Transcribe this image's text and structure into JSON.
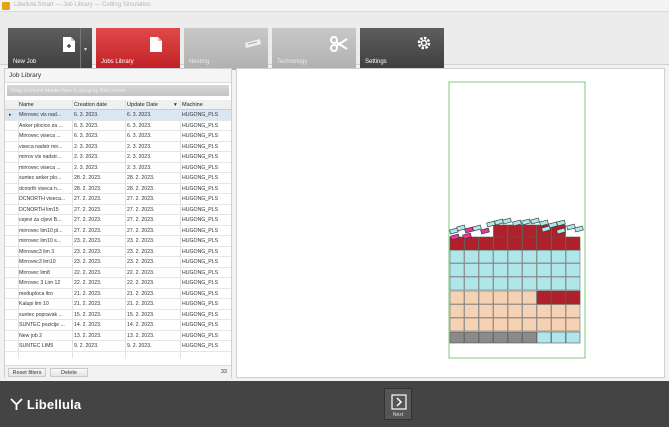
{
  "window": {
    "title": "Libellula.Smart — Job Library — Cutting Simulation"
  },
  "ribbon": {
    "new_job": "New Job",
    "job_library": "Jobs Library",
    "nesting": "Nesting",
    "technology": "Technology",
    "settings": "Settings"
  },
  "panel": {
    "title": "Job Library",
    "group_hint": "Drag a column header here to group by that column",
    "columns": [
      "Name",
      "Creation date",
      "Update Date",
      "Machine"
    ],
    "rows": [
      [
        "Mirrovec vis nad...",
        "6. 3. 2023.",
        "6. 3. 2023.",
        "HUGONG_PLS"
      ],
      [
        "Anker plocice za ...",
        "6. 3. 2023.",
        "6. 3. 2023.",
        "HUGONG_PLS"
      ],
      [
        "Mirrovec viseca ...",
        "6. 3. 2023.",
        "6. 3. 2023.",
        "HUGONG_PLS"
      ],
      [
        "viseca nadstr mir...",
        "2. 3. 2023.",
        "2. 3. 2023.",
        "HUGONG_PLS"
      ],
      [
        "mirrov vis nadstr...",
        "2. 3. 2023.",
        "2. 3. 2023.",
        "HUGONG_PLS"
      ],
      [
        "mirrovec viseca ...",
        "2. 3. 2023.",
        "2. 3. 2023.",
        "HUGONG_PLS"
      ],
      [
        "suntec anker plo...",
        "28. 2. 2023.",
        "28. 2. 2023.",
        "HUGONG_PLS"
      ],
      [
        "dcnorth viseca n...",
        "28. 2. 2023.",
        "28. 2. 2023.",
        "HUGONG_PLS"
      ],
      [
        "DCNORTH viseca...",
        "27. 2. 2023.",
        "27. 2. 2023.",
        "HUGONG_PLS"
      ],
      [
        "DCNORTH lim15",
        "27. 2. 2023.",
        "27. 2. 2023.",
        "HUGONG_PLS"
      ],
      [
        "cejevi za cijevi B...",
        "27. 2. 2023.",
        "27. 2. 2023.",
        "HUGONG_PLS"
      ],
      [
        "mirrovec lim10 pl...",
        "27. 2. 2023.",
        "27. 2. 2023.",
        "HUGONG_PLS"
      ],
      [
        "mirrovec lim10 s...",
        "23. 2. 2023.",
        "23. 2. 2023.",
        "HUGONG_PLS"
      ],
      [
        "Mirrovec3 lim 3",
        "23. 2. 2023.",
        "23. 2. 2023.",
        "HUGONG_PLS"
      ],
      [
        "Mirrovec3 lim10",
        "23. 2. 2023.",
        "23. 2. 2023.",
        "HUGONG_PLS"
      ],
      [
        "Mirrovec lim8",
        "22. 2. 2023.",
        "22. 2. 2023.",
        "HUGONG_PLS"
      ],
      [
        "Mirrovec 3 Lim 12",
        "22. 2. 2023.",
        "22. 2. 2023.",
        "HUGONG_PLS"
      ],
      [
        "međuploca itro",
        "21. 2. 2023.",
        "21. 2. 2023.",
        "HUGONG_PLS"
      ],
      [
        "Kalupi lim 10",
        "21. 2. 2023.",
        "21. 2. 2023.",
        "HUGONG_PLS"
      ],
      [
        "suntec popravak ...",
        "15. 2. 2023.",
        "15. 2. 2023.",
        "HUGONG_PLS"
      ],
      [
        "SUNTEC pozicije ...",
        "14. 2. 2023.",
        "14. 2. 2023.",
        "HUGONG_PLS"
      ],
      [
        "New job 2",
        "13. 2. 2023.",
        "13. 2. 2023.",
        "HUGONG_PLS"
      ],
      [
        "SUNTEC LIM5",
        "9. 2. 2023.",
        "9. 2. 2023.",
        "HUGONG_PLS"
      ]
    ],
    "reset_filters": "Reset filters",
    "delete": "Delete",
    "count": "33"
  },
  "footer": {
    "brand": "Libellula",
    "next": "Next"
  },
  "colors": {
    "accent": "#c01f25",
    "part_red": "#b0202a",
    "part_cyan": "#aee6ea",
    "part_peach": "#f6d2b4",
    "part_pink": "#e0399a",
    "part_gray": "#8a8a8a",
    "sheet_border": "#2aa52a"
  }
}
